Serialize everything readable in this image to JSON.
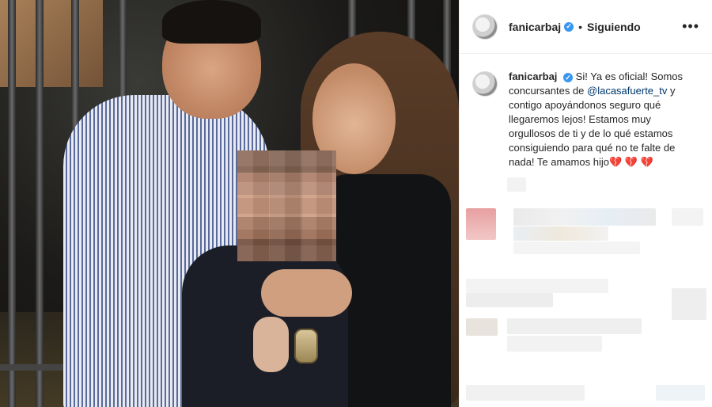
{
  "post": {
    "username": "fanicarbaj",
    "verified_symbol": "✓",
    "separator": "•",
    "follow_state": "Siguiendo",
    "more_icon": "•••",
    "caption": {
      "before_mention": "Si! Ya es oficial! Somos concursantes de ",
      "mention": "@lacasafuerte_tv",
      "after_mention": " y contigo apoyándonos seguro qué llegaremos lejos! Estamos muy orgullosos de ti y de lo qué estamos consiguiendo para qué no te falte de nada! Te amamos hijo",
      "hearts": "💔 💔 💔"
    }
  },
  "colors": {
    "verified": "#3897f0",
    "mention": "#00376b",
    "divider": "#efefef"
  }
}
